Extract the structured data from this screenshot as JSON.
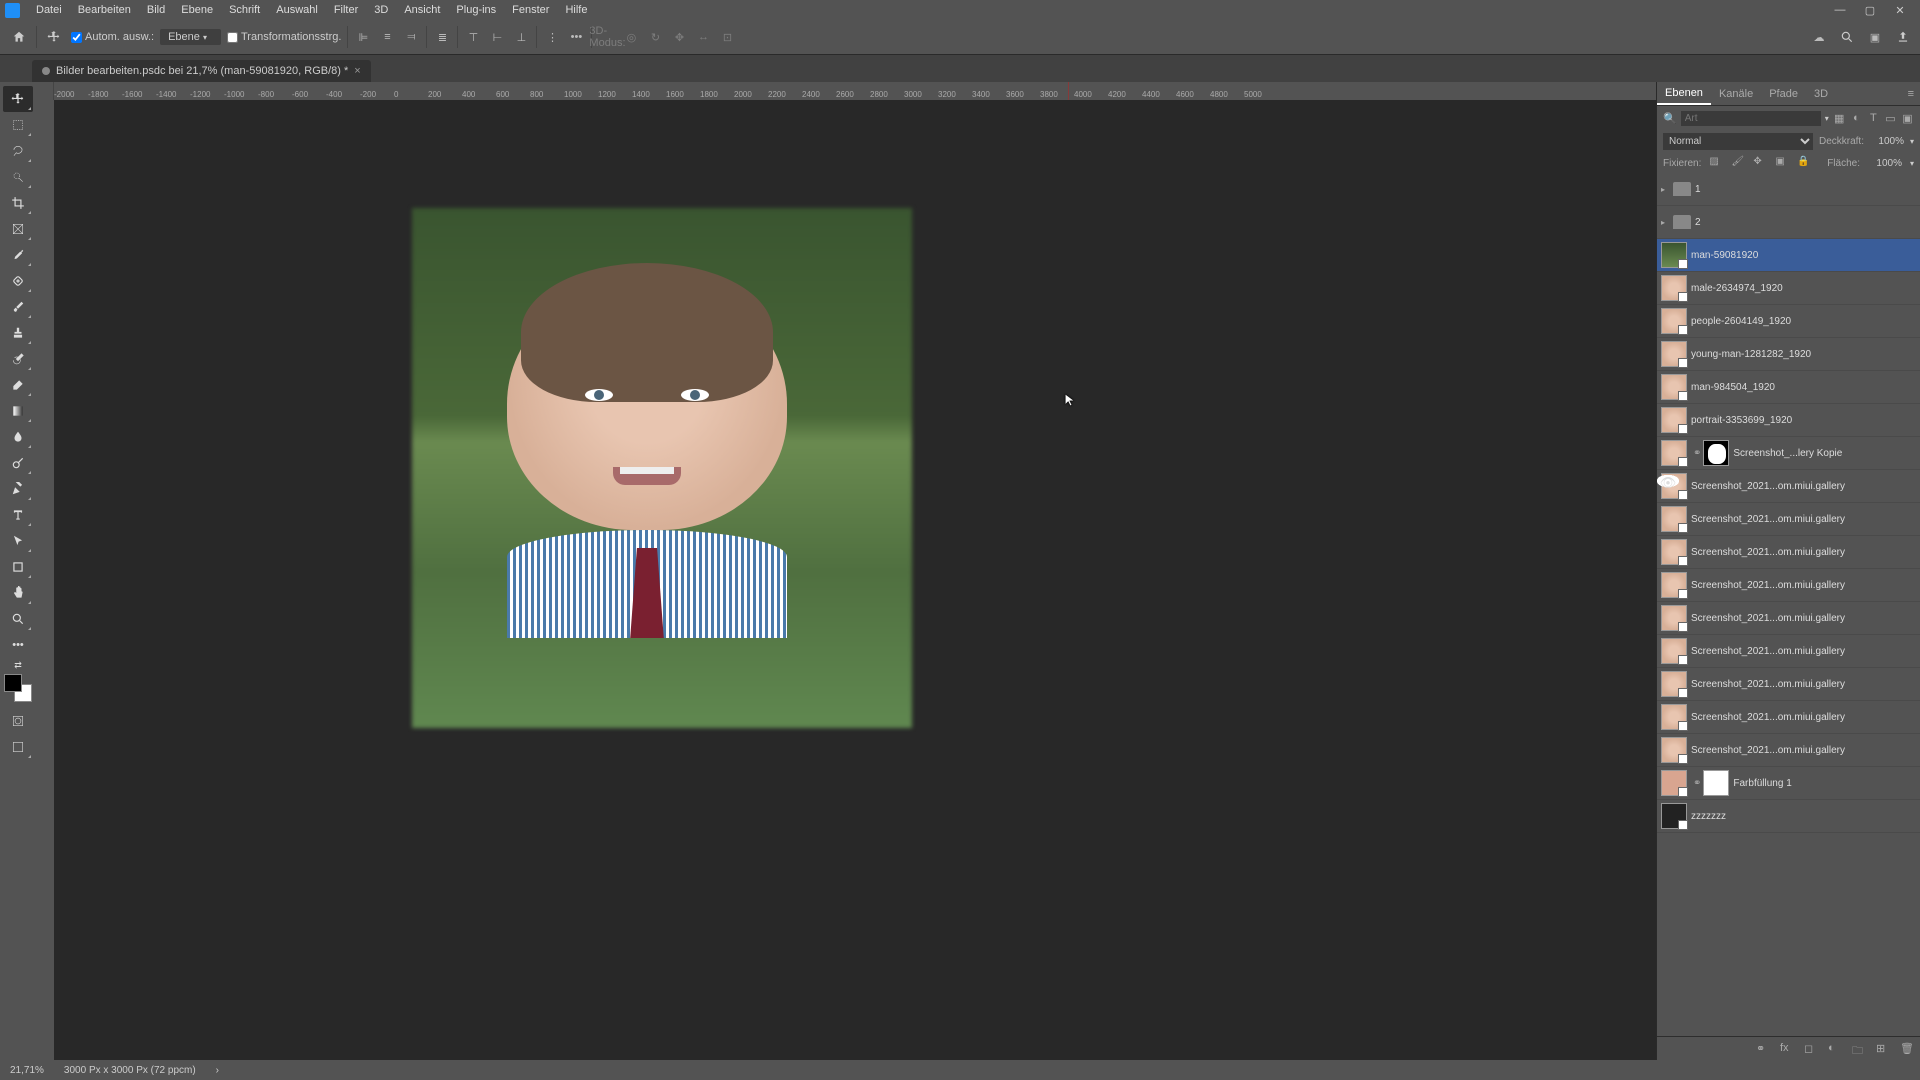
{
  "menubar": {
    "items": [
      "Datei",
      "Bearbeiten",
      "Bild",
      "Ebene",
      "Schrift",
      "Auswahl",
      "Filter",
      "3D",
      "Ansicht",
      "Plug-ins",
      "Fenster",
      "Hilfe"
    ]
  },
  "optbar": {
    "auto_select_checked": true,
    "auto_select_label": "Autom. ausw.:",
    "select_mode": "Ebene",
    "transform_checked": false,
    "transform_label": "Transformationsstrg.",
    "mode3d_label": "3D-Modus:"
  },
  "tab": {
    "title": "Bilder bearbeiten.psdc bei 21,7% (man-59081920, RGB/8) *"
  },
  "ruler": {
    "numbers": [
      "-2000",
      "-1800",
      "-1600",
      "-1400",
      "-1200",
      "-1000",
      "-800",
      "-600",
      "-400",
      "-200",
      "0",
      "200",
      "400",
      "600",
      "800",
      "1000",
      "1200",
      "1400",
      "1600",
      "1800",
      "2000",
      "2200",
      "2400",
      "2600",
      "2800",
      "3000",
      "3200",
      "3400",
      "3600",
      "3800",
      "4000",
      "4200",
      "4400",
      "4600",
      "4800",
      "5000"
    ]
  },
  "panels": {
    "tabs": [
      "Ebenen",
      "Kanäle",
      "Pfade",
      "3D"
    ],
    "search_placeholder": "Art",
    "blend_mode": "Normal",
    "opacity_label": "Deckkraft:",
    "opacity_value": "100%",
    "lock_label": "Fixieren:",
    "fill_label": "Fläche:",
    "fill_value": "100%"
  },
  "layers": [
    {
      "type": "group",
      "name": "1",
      "visible": false
    },
    {
      "type": "group",
      "name": "2",
      "visible": false
    },
    {
      "type": "layer",
      "name": "man-59081920",
      "visible": true,
      "selected": true,
      "thumb": "green"
    },
    {
      "type": "layer",
      "name": "male-2634974_1920",
      "visible": false,
      "thumb": "face"
    },
    {
      "type": "layer",
      "name": "people-2604149_1920",
      "visible": false,
      "thumb": "face"
    },
    {
      "type": "layer",
      "name": "young-man-1281282_1920",
      "visible": false,
      "thumb": "face"
    },
    {
      "type": "layer",
      "name": "man-984504_1920",
      "visible": false,
      "thumb": "face"
    },
    {
      "type": "layer",
      "name": "portrait-3353699_1920",
      "visible": false,
      "thumb": "face"
    },
    {
      "type": "layer",
      "name": "Screenshot_...lery Kopie",
      "visible": false,
      "thumb": "face",
      "mask": "shape",
      "link": true
    },
    {
      "type": "layer",
      "name": "Screenshot_2021...om.miui.gallery",
      "visible": false,
      "thumb": "face"
    },
    {
      "type": "layer",
      "name": "Screenshot_2021...om.miui.gallery",
      "visible": false,
      "thumb": "face"
    },
    {
      "type": "layer",
      "name": "Screenshot_2021...om.miui.gallery",
      "visible": false,
      "thumb": "face"
    },
    {
      "type": "layer",
      "name": "Screenshot_2021...om.miui.gallery",
      "visible": false,
      "thumb": "face"
    },
    {
      "type": "layer",
      "name": "Screenshot_2021...om.miui.gallery",
      "visible": false,
      "thumb": "face"
    },
    {
      "type": "layer",
      "name": "Screenshot_2021...om.miui.gallery",
      "visible": false,
      "thumb": "face"
    },
    {
      "type": "layer",
      "name": "Screenshot_2021...om.miui.gallery",
      "visible": false,
      "thumb": "face"
    },
    {
      "type": "layer",
      "name": "Screenshot_2021...om.miui.gallery",
      "visible": false,
      "thumb": "face"
    },
    {
      "type": "layer",
      "name": "Screenshot_2021...om.miui.gallery",
      "visible": false,
      "thumb": "face"
    },
    {
      "type": "layer",
      "name": "Farbfüllung 1",
      "visible": false,
      "thumb": "color",
      "mask": "white",
      "link": true
    },
    {
      "type": "layer",
      "name": "zzzzzzz",
      "visible": true,
      "thumb": "dark"
    }
  ],
  "statusbar": {
    "zoom": "21,71%",
    "dims": "3000 Px x 3000 Px (72 ppcm)"
  }
}
